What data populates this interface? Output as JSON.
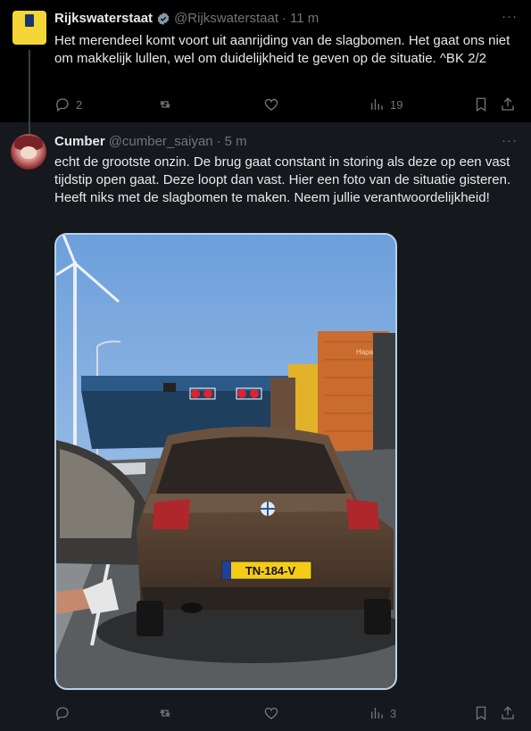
{
  "post1": {
    "author_name": "Rijkswaterstaat",
    "handle": "@Rijkswaterstaat",
    "time": "11 m",
    "text": "Het merendeel komt voort uit aanrijding van de slagbomen. Het gaat ons niet om makkelijk lullen, wel om duidelijkheid te geven op de situatie. ^BK 2/2",
    "replies": "2",
    "reposts": "",
    "likes": "",
    "views": "19"
  },
  "post2": {
    "author_name": "Cumber",
    "handle": "@cumber_saiyan",
    "time": "5 m",
    "text": "echt de grootste onzin.  De brug gaat constant in storing als deze op een vast tijdstip open gaat. Deze loopt dan vast.  Hier een foto van de situatie gisteren. Heeft niks met de slagbomen te maken. Neem jullie verantwoordelijkheid!",
    "replies": "",
    "reposts": "",
    "likes": "",
    "views": "3",
    "photo": {
      "plate": "TN-184-V",
      "container_text": "Hapag-Lloyd"
    }
  },
  "colors": {
    "background_top": "#000000",
    "background_reply": "#15181c",
    "text": "#e7e9ea",
    "muted": "#71767b",
    "verified_badge": "#829aab",
    "avatar_rws": "#f4d637"
  },
  "icons": [
    "verified-badge-icon",
    "more-icon",
    "reply-icon",
    "repost-icon",
    "like-icon",
    "views-icon",
    "bookmark-icon",
    "share-icon"
  ]
}
